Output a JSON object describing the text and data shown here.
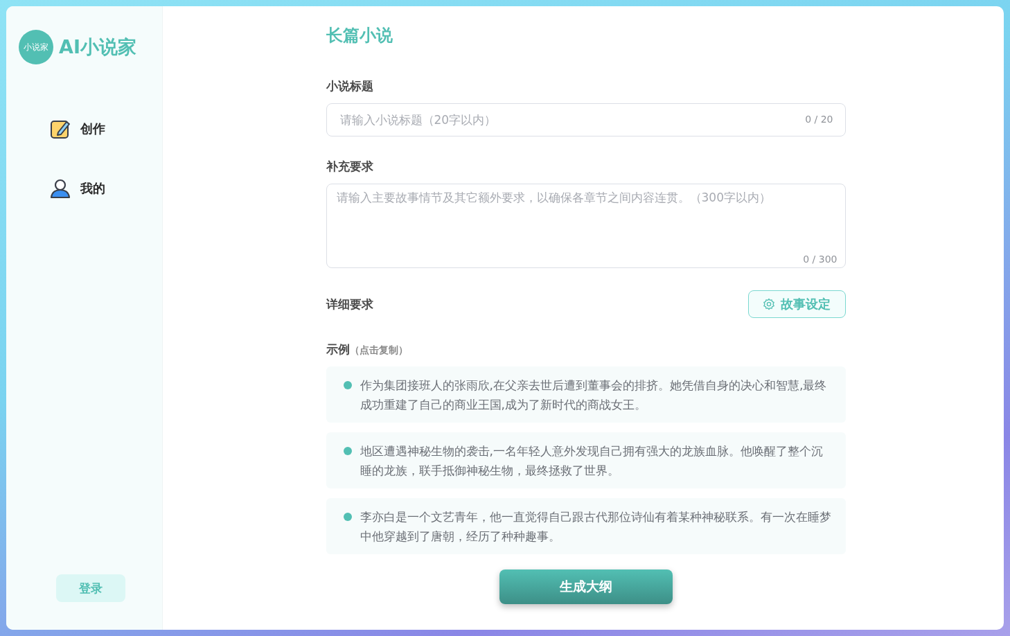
{
  "sidebar": {
    "logo_badge": "小说家",
    "logo_text": "AI小说家",
    "nav": [
      {
        "label": "创作",
        "kind": "edit"
      },
      {
        "label": "我的",
        "kind": "user"
      }
    ],
    "login": "登录"
  },
  "main": {
    "heading": "长篇小说",
    "title_field": {
      "label": "小说标题",
      "placeholder": "请输入小说标题（20字以内）",
      "counter": "0 / 20"
    },
    "extra_field": {
      "label": "补充要求",
      "placeholder": "请输入主要故事情节及其它额外要求，以确保各章节之间内容连贯。（300字以内）",
      "counter": "0 / 300"
    },
    "detail_label": "详细要求",
    "story_button": "故事设定",
    "examples_label": "示例",
    "examples_hint": "（点击复制）",
    "examples": [
      "作为集团接班人的张雨欣,在父亲去世后遭到董事会的排挤。她凭借自身的决心和智慧,最终成功重建了自己的商业王国,成为了新时代的商战女王。",
      "地区遭遇神秘生物的袭击,一名年轻人意外发现自己拥有强大的龙族血脉。他唤醒了整个沉睡的龙族，联手抵御神秘生物，最终拯救了世界。",
      "李亦白是一个文艺青年，他一直觉得自己跟古代那位诗仙有着某种神秘联系。有一次在睡梦中他穿越到了唐朝，经历了种种趣事。"
    ],
    "generate_button": "生成大纲"
  }
}
